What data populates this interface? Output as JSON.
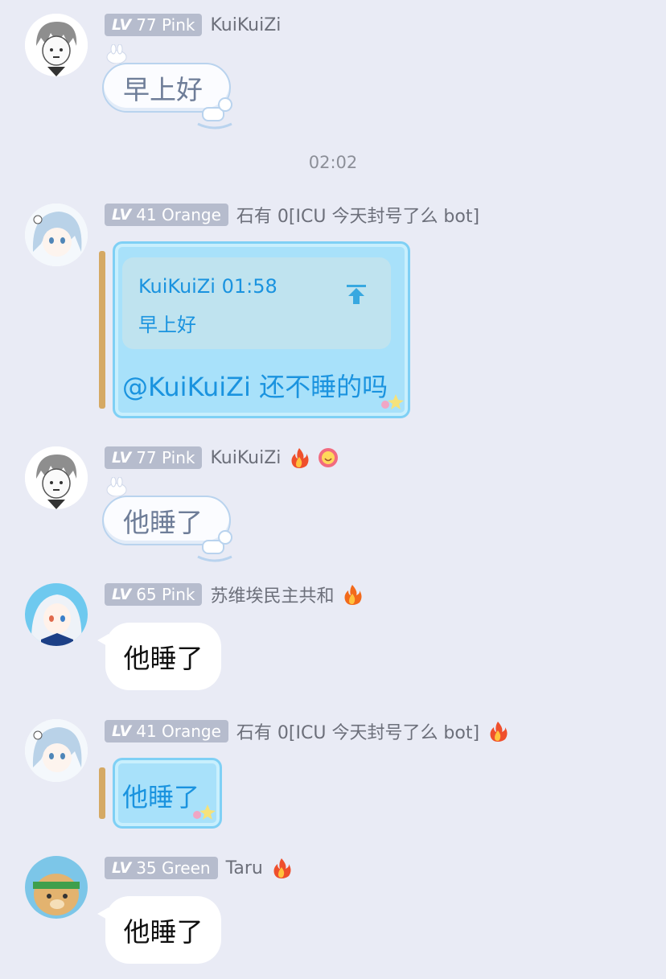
{
  "timestamp": "02:02",
  "messages": [
    {
      "level_prefix": "LV",
      "level": "77",
      "level_color": "Pink",
      "nickname": "KuiKuiZi",
      "text": "早上好"
    },
    {
      "level_prefix": "LV",
      "level": "41",
      "level_color": "Orange",
      "nickname": "石有 0[ICU 今天封号了么 bot]",
      "quote": {
        "author": "KuiKuiZi",
        "time": "01:58",
        "text": "早上好"
      },
      "text": "@KuiKuiZi 还不睡的吗"
    },
    {
      "level_prefix": "LV",
      "level": "77",
      "level_color": "Pink",
      "nickname": "KuiKuiZi",
      "text": "他睡了"
    },
    {
      "level_prefix": "LV",
      "level": "65",
      "level_color": "Pink",
      "nickname": "苏维埃民主共和",
      "text": "他睡了"
    },
    {
      "level_prefix": "LV",
      "level": "41",
      "level_color": "Orange",
      "nickname": "石有 0[ICU 今天封号了么 bot]",
      "text": "他睡了"
    },
    {
      "level_prefix": "LV",
      "level": "35",
      "level_color": "Green",
      "nickname": "Taru",
      "text": "他睡了"
    }
  ],
  "colors": {
    "background": "#e9ebf5",
    "badge": "#b6bccd",
    "jar_text": "#1a93df",
    "cloud_text": "#6e7d98"
  }
}
